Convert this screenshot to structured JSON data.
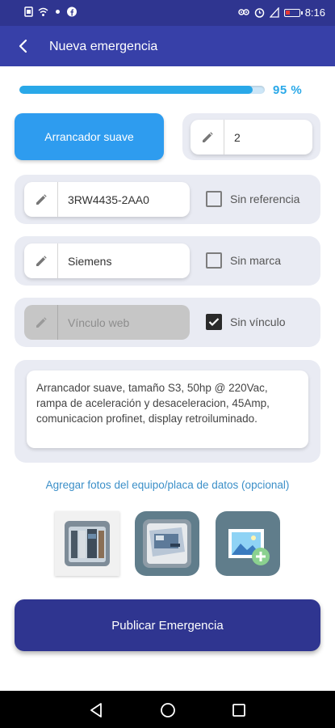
{
  "status_bar": {
    "time": "8:16"
  },
  "app_bar": {
    "title": "Nueva emergencia"
  },
  "progress": {
    "value_percent": 95,
    "label": "95 %"
  },
  "form": {
    "equipment_type_label": "Arrancador suave",
    "quantity_value": "2",
    "reference_value": "3RW4435-2AA0",
    "no_reference_label": "Sin referencia",
    "no_reference_checked": false,
    "brand_value": "Siemens",
    "no_brand_label": "Sin marca",
    "no_brand_checked": false,
    "web_link_placeholder": "Vínculo web",
    "no_link_label": "Sin vínculo",
    "no_link_checked": true,
    "description": "Arrancador suave, tamaño S3, 50hp @ 220Vac, rampa de aceleración y desaceleracion, 45Amp, comunicacion profinet, display retroiluminado."
  },
  "photos": {
    "add_photos_label": "Agregar fotos del equipo/placa de datos (opcional)",
    "items": [
      "photo-1",
      "photo-2",
      "add-photo"
    ]
  },
  "publish_button": "Publicar Emergencia",
  "colors": {
    "primary_dark": "#2f3590",
    "app_bar": "#3740a8",
    "accent_blue": "#29a8e8",
    "button_blue": "#2e9cef",
    "card_bg": "#e9ebf3"
  }
}
